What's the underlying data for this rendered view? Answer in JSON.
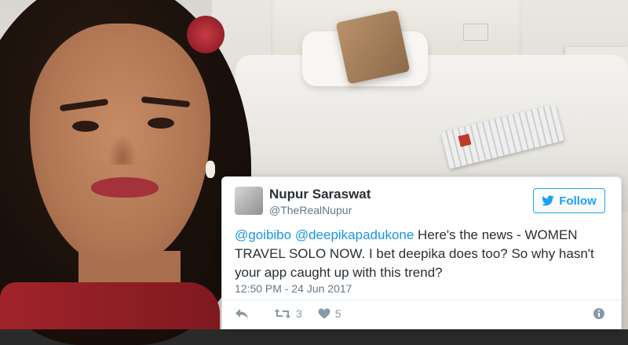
{
  "tweet": {
    "display_name": "Nupur Saraswat",
    "handle": "@TheRealNupur",
    "follow_label": "Follow",
    "mention_1": "@goibibo",
    "mention_2": "@deepikapadukone",
    "body": " Here's the news - WOMEN TRAVEL SOLO NOW. I bet deepika does too? So why hasn't your app caught up with this trend?",
    "timestamp": "12:50 PM - 24 Jun 2017",
    "retweet_count": "3",
    "like_count": "5"
  },
  "icons": {
    "follow": "twitter-bird-icon",
    "reply": "reply-icon",
    "retweet": "retweet-icon",
    "like": "heart-icon",
    "info": "info-icon"
  },
  "colors": {
    "twitter_blue": "#1da1f2",
    "mention_blue": "#1b95e0",
    "text": "#292f33",
    "muted": "#657786"
  }
}
